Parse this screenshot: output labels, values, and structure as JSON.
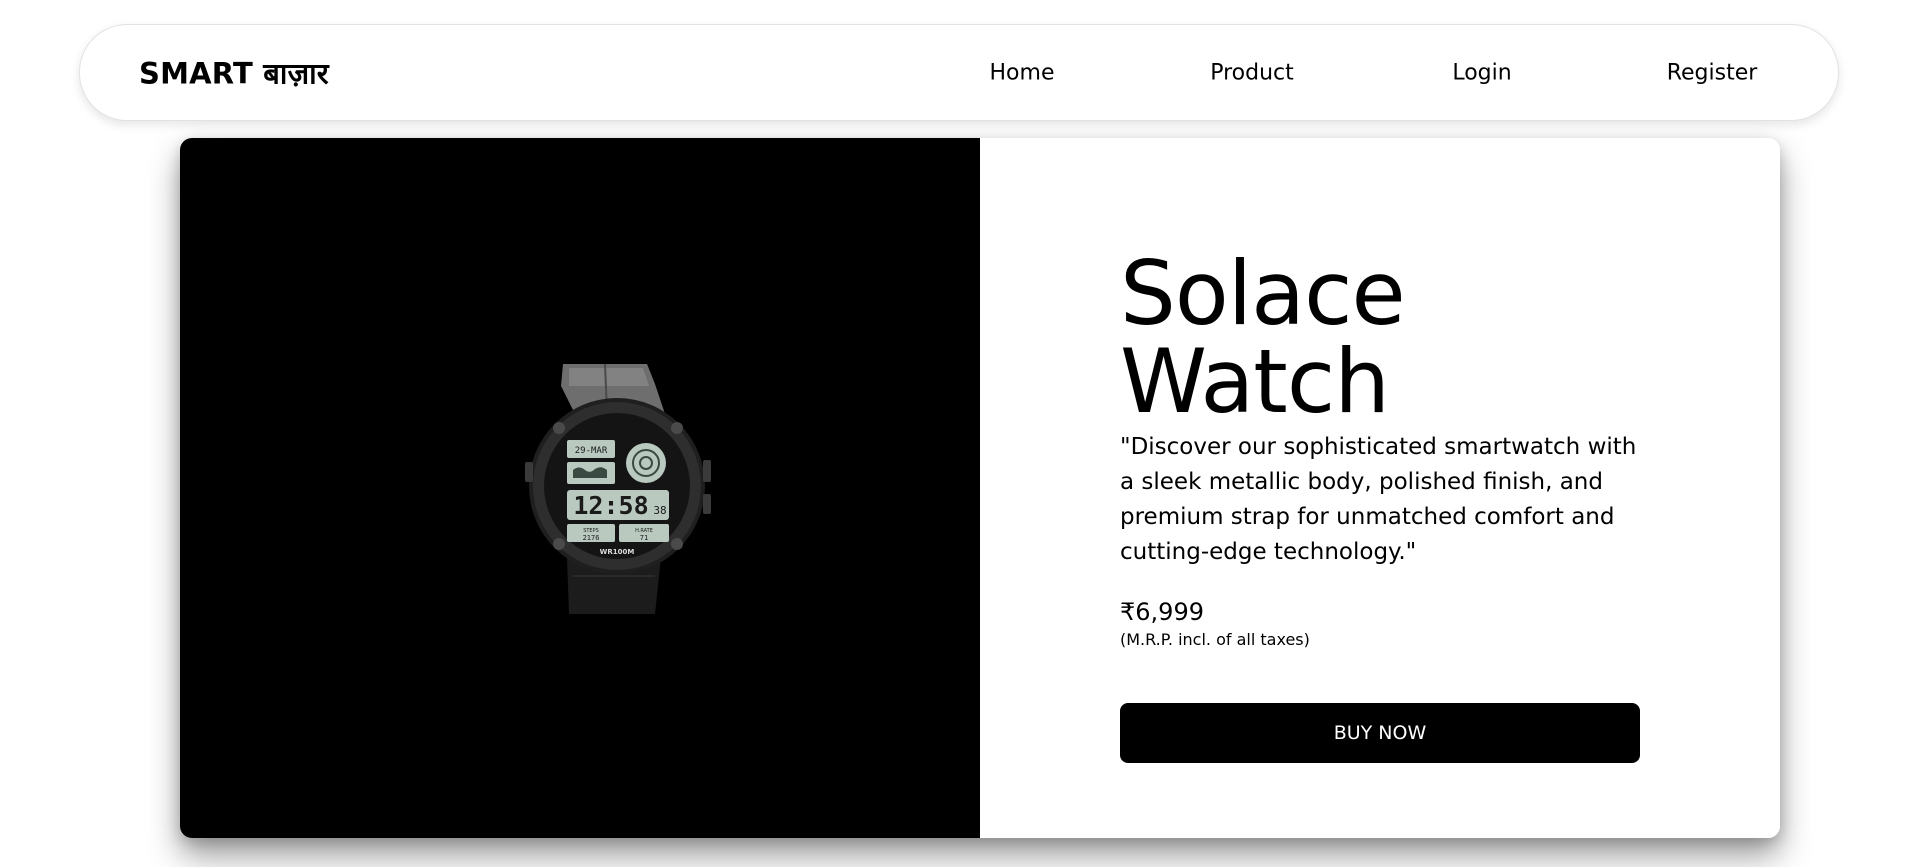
{
  "navbar": {
    "brand": "SMART बाज़ार",
    "links": [
      "Home",
      "Product",
      "Login",
      "Register"
    ]
  },
  "product": {
    "name_line1": "Solace",
    "name_line2": "Watch",
    "description": "\"Discover our sophisticated smartwatch with a sleek metallic body, polished finish, and premium strap for unmatched comfort and cutting-edge technology.\"",
    "price": "₹6,999",
    "tax_note": "(M.R.P. incl. of all taxes)",
    "buy_label": "BUY NOW",
    "image": {
      "subject": "black-digital-watch",
      "watch_face": {
        "date": "29-MAR",
        "time": "12:58",
        "seconds": "38",
        "steps_label": "STEPS",
        "steps_value": "2176",
        "heart_rate_label": "H.RATE",
        "heart_rate_value": "71",
        "brand_text": "WR100M"
      }
    }
  },
  "colors": {
    "image_background": "#000000",
    "button_background": "#000000",
    "button_text": "#ffffff",
    "lcd": "#b9c9c0"
  }
}
